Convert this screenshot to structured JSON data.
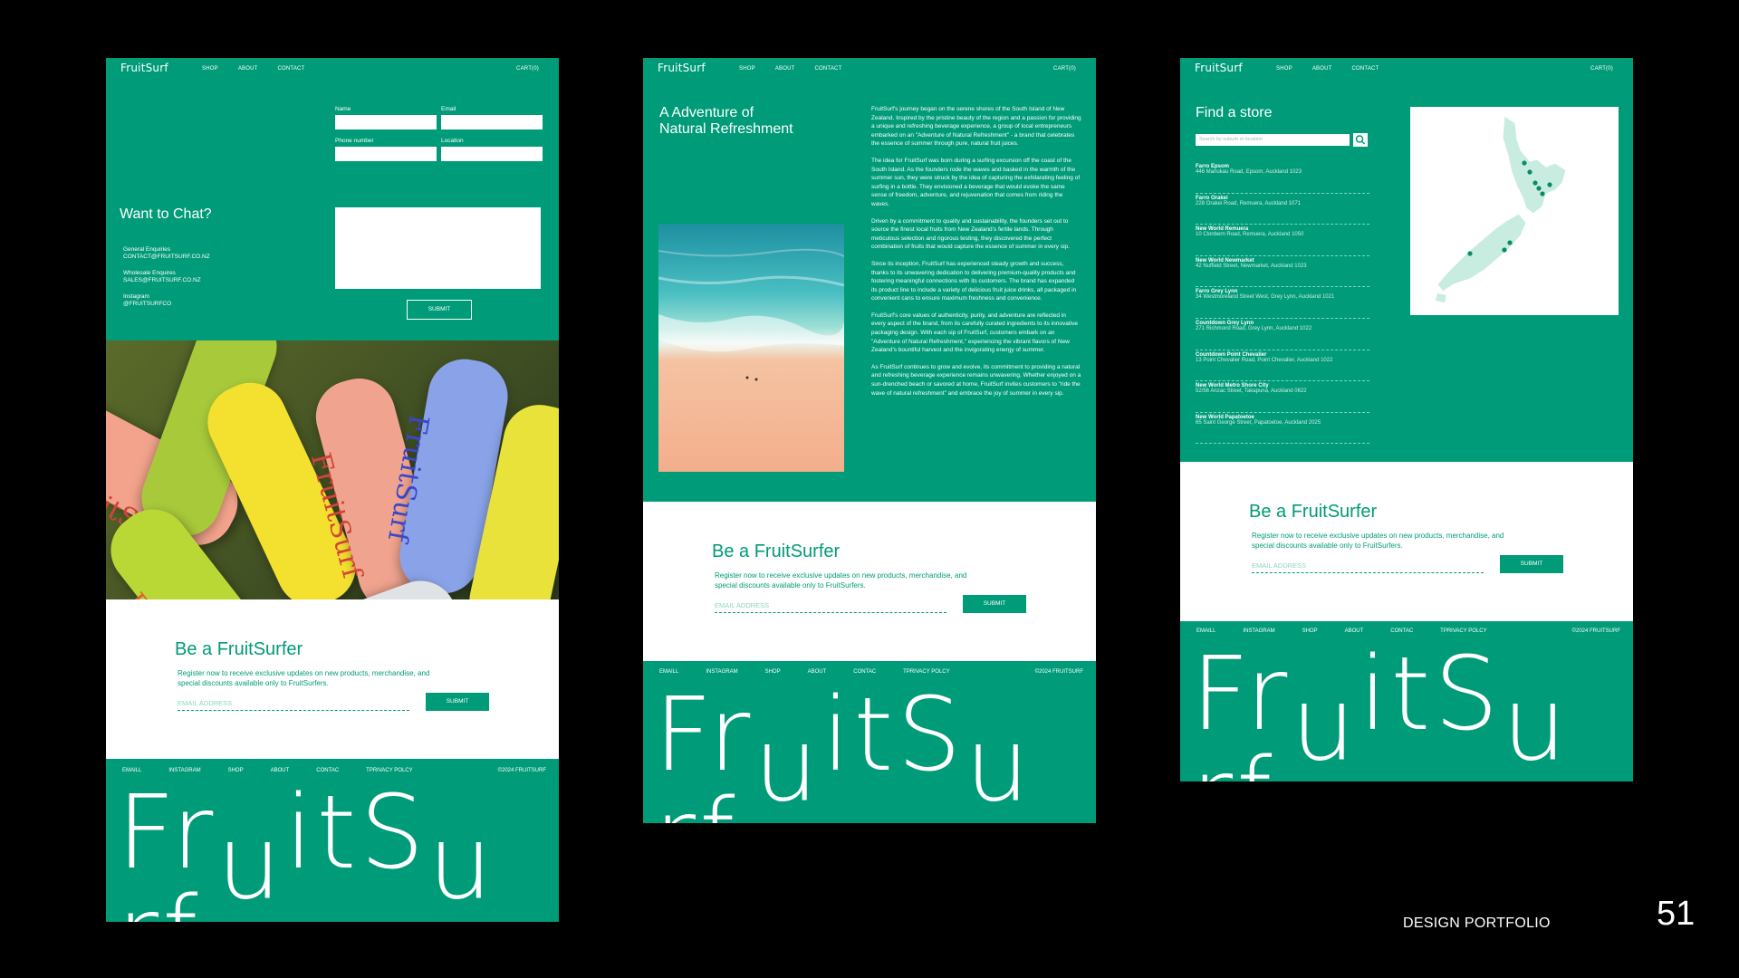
{
  "brand": "FruitSurf",
  "nav": {
    "logo": "FruitSurf",
    "links": [
      "SHOP",
      "ABOUT",
      "CONTACT"
    ],
    "cart": "CART(0)"
  },
  "contact": {
    "heading": "Want to Chat?",
    "fields": {
      "name": "Name",
      "email": "Email",
      "phone": "Phone number",
      "location": "Location"
    },
    "submit": "SUBMIT",
    "general_label": "General Enquiries",
    "general_value": "CONTACT@FRUITSURF.CO.NZ",
    "wholesale_label": "Wholesale Enquires",
    "wholesale_value": "SALES@FRUITSURF.CO.NZ",
    "instagram_label": "Instagram",
    "instagram_value": "@FRUITSURFCO"
  },
  "cans": {
    "label": "FruitSurf"
  },
  "subscribe": {
    "heading": "Be a FruitSurfer",
    "text": "Register now to receive exclusive updates on new products, merchandise, and special discounts available only to FruitSurfers.",
    "placeholder": "EMAIL ADDRESS",
    "submit": "SUBMIT"
  },
  "footer": {
    "links": [
      "EMAILL",
      "INSTAGRAM",
      "SHOP",
      "ABOUT",
      "CONTAC",
      "TPRIVACY POLCY"
    ],
    "copyright": "©2024 FRUITSURF",
    "wordmark_start": "Fr",
    "wordmark_u1": "u",
    "wordmark_mid": "itS",
    "wordmark_u2": "u",
    "wordmark_end": "rf"
  },
  "about": {
    "heading_line1": "A Adventure of",
    "heading_line2": "Natural Refreshment",
    "paragraphs": [
      "FruitSurf's journey began on the serene shores of the South Island of New Zealand. Inspired by the pristine beauty of the region and a passion for providing a unique and refreshing beverage experience, a group of local entrepreneurs embarked on an \"Adventure of Natural Refreshment\" - a brand that celebrates the essence of summer through pure, natural fruit juices.",
      "The idea for FruitSurf was born during a surfing excursion off the coast of the South Island. As the founders rode the waves and basked in the warmth of the summer sun, they were struck by the idea of capturing the exhilarating feeling of surfing in a bottle. They envisioned a beverage that would evoke the same sense of freedom, adventure, and rejuvenation that comes from riding the waves.",
      "Driven by a commitment to quality and sustainability, the founders set out to source the finest local fruits from New Zealand's fertile lands. Through meticulous selection and rigorous testing, they discovered the perfect combination of fruits that would capture the essence of summer in every sip.",
      "Since its inception, FruitSurf has experienced steady growth and success, thanks to its unwavering dedication to delivering premium-quality products and fostering meaningful connections with its customers. The brand has expanded its product line to include a variety of delicious fruit juice drinks, all packaged in convenient cans to ensure maximum freshness and convenience.",
      "FruitSurf's core values of authenticity, purity, and adventure are reflected in every aspect of the brand, from its carefully curated ingredients to its innovative packaging design. With each sip of FruitSurf, customers embark on an \"Adventure of Natural Refreshment,\" experiencing the vibrant flavors of New Zealand's bountiful harvest and the invigorating energy of summer.",
      "As FruitSurf continues to grow and evolve, its commitment to providing a natural and refreshing beverage experience remains unwavering. Whether enjoyed on a sun-drenched beach or savored at home, FruitSurf invites customers to \"ride the wave of natural refreshment\" and embrace the joy of summer in every sip."
    ]
  },
  "stores": {
    "heading": "Find a store",
    "search_placeholder": "Search by suburb or location",
    "list": [
      {
        "name": "Farro Epsom",
        "address": "446 Manukau Road, Epsom, Auckland 1023"
      },
      {
        "name": "Farro Orakei",
        "address": "228 Orakei Road, Remuera, Auckland 1071"
      },
      {
        "name": "New World Remuera",
        "address": "10 Clonbern Road, Remuera, Auckland 1050"
      },
      {
        "name": "New World Newmarket",
        "address": "42 Nuffield Street, Newmarket, Auckland 1023"
      },
      {
        "name": "Farro Grey Lynn",
        "address": "34 Westmoreland Street West, Grey Lynn, Auckland 1021"
      },
      {
        "name": "Countdown Grey Lynn",
        "address": "271 Richmond Road, Grey Lynn, Auckland 1022"
      },
      {
        "name": "Countdown Point Chevalier",
        "address": "13 Point Chevalier Road, Point Chevalier, Auckland 1022"
      },
      {
        "name": "New World Metro Shore City",
        "address": "52/56 Anzac Street, Takapuna, Auckland 0622"
      },
      {
        "name": "New World Papatoetoe",
        "address": "65 Saint George Street, Papatoetoe, Auckland 2025"
      }
    ]
  },
  "slide": {
    "caption": "DESIGN PORTFOLIO",
    "page": "51"
  },
  "colors": {
    "brand_green": "#009b78",
    "background": "#000000",
    "map_land": "#c9ece0",
    "map_pin": "#0a8a68"
  },
  "icons": [
    "search-icon",
    "map-pin-icon"
  ]
}
